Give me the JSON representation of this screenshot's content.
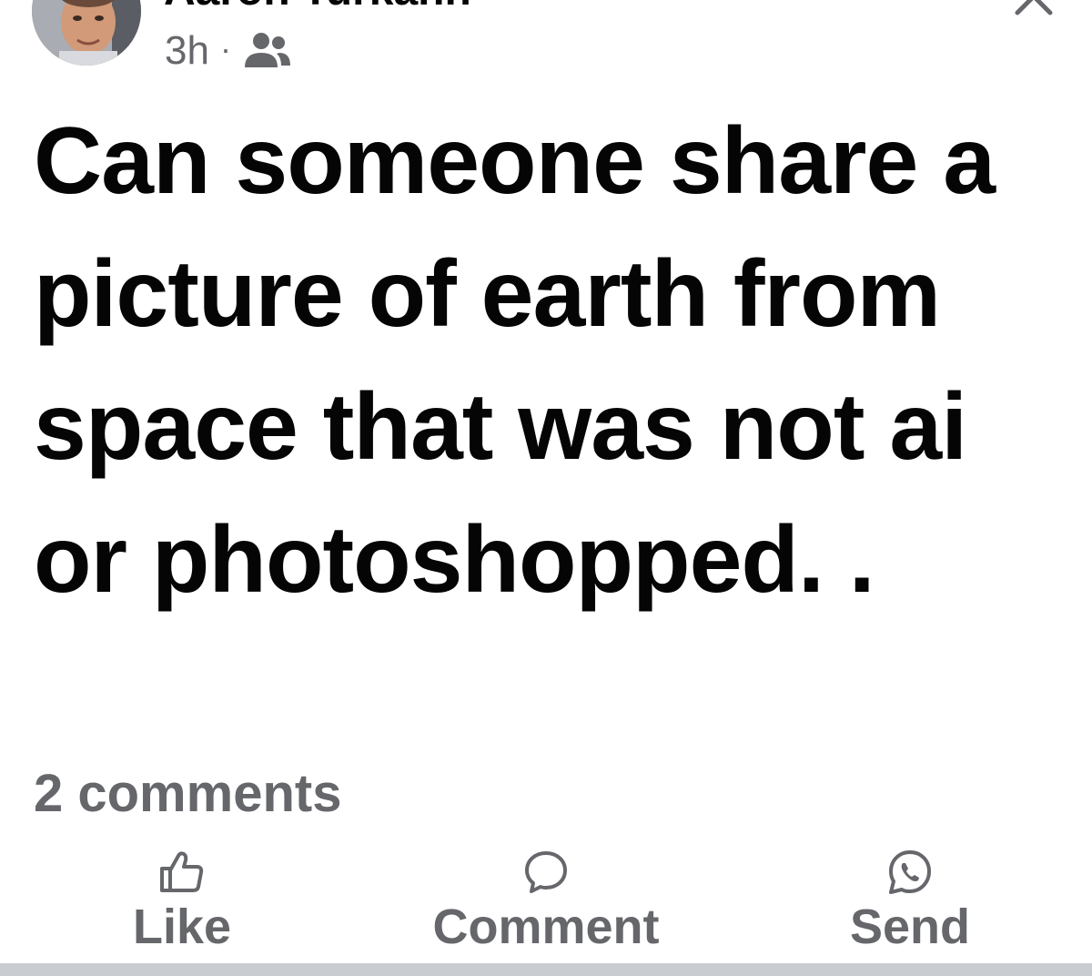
{
  "post": {
    "author_name": "Aaron Turkahn",
    "timestamp": "3h",
    "separator": "·",
    "audience_icon": "friends-icon",
    "text": "Can someone share a picture of earth from space that was not ai or photoshopped. .",
    "comments_count": "2 comments"
  },
  "actions": {
    "like": {
      "label": "Like",
      "icon": "thumbs-up-icon"
    },
    "comment": {
      "label": "Comment",
      "icon": "comment-bubble-icon"
    },
    "send": {
      "label": "Send",
      "icon": "whatsapp-icon"
    }
  },
  "colors": {
    "text_primary": "#050505",
    "text_secondary": "#65676b",
    "divider": "#c9ccd1"
  }
}
